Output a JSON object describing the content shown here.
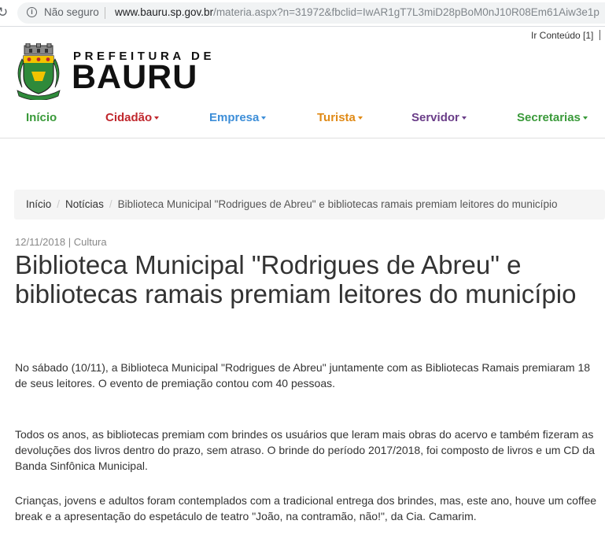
{
  "browser": {
    "security_label": "Não seguro",
    "url_host": "www.bauru.sp.gov.br",
    "url_path": "/materia.aspx?n=31972&fbclid=IwAR1gT7L3miD28pBoM0nJ10R08Em61Aiw3e1p"
  },
  "header": {
    "skip_link": "Ir Conteúdo [1]",
    "logo_line1": "PREFEITURA DE",
    "logo_line2": "BAURU"
  },
  "nav": [
    {
      "label": "Início",
      "color": "#3a9a3a",
      "dropdown": false
    },
    {
      "label": "Cidadão",
      "color": "#c0272d",
      "dropdown": true
    },
    {
      "label": "Empresa",
      "color": "#3d8ed8",
      "dropdown": true
    },
    {
      "label": "Turista",
      "color": "#e08a16",
      "dropdown": true
    },
    {
      "label": "Servidor",
      "color": "#6a3d88",
      "dropdown": true
    },
    {
      "label": "Secretarias",
      "color": "#3a9a3a",
      "dropdown": true
    }
  ],
  "breadcrumb": {
    "home": "Início",
    "news": "Notícias",
    "current": "Biblioteca Municipal \"Rodrigues de Abreu\" e bibliotecas ramais premiam leitores do município"
  },
  "article": {
    "meta": "12/11/2018 | Cultura",
    "title": "Biblioteca Municipal \"Rodrigues de Abreu\" e bibliotecas ramais premiam leitores do município",
    "paragraphs": [
      "No sábado (10/11), a Biblioteca Municipal \"Rodrigues de Abreu\" juntamente com as Bibliotecas Ramais premiaram 18 de seus leitores. O evento de premiação contou com 40 pessoas.",
      "Todos os anos, as bibliotecas premiam com brindes os usuários que leram mais obras do acervo e também fizeram as devoluções dos livros dentro do prazo, sem atraso. O brinde do período 2017/2018, foi composto de livros e um CD da Banda Sinfônica Municipal.",
      "Crianças, jovens e adultos foram contemplados com a tradicional entrega dos brindes, mas, este ano, houve um coffee break e a apresentação do espetáculo de teatro \"João, na contramão, não!\", da Cia. Camarim."
    ]
  }
}
